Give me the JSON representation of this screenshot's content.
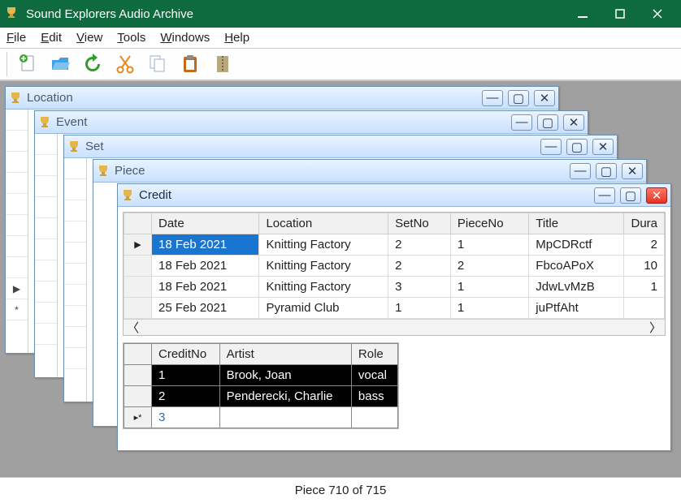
{
  "app": {
    "title": "Sound Explorers Audio Archive"
  },
  "menus": {
    "file": "File",
    "edit": "Edit",
    "view": "View",
    "tools": "Tools",
    "windows": "Windows",
    "help": "Help"
  },
  "windows": {
    "location": "Location",
    "event": "Event",
    "set": "Set",
    "piece": "Piece",
    "credit": "Credit"
  },
  "masterGrid": {
    "headers": {
      "date": "Date",
      "location": "Location",
      "setno": "SetNo",
      "pieceno": "PieceNo",
      "title": "Title",
      "duration": "Dura"
    },
    "rows": [
      {
        "date": "18 Feb 2021",
        "location": "Knitting Factory",
        "setno": "2",
        "pieceno": "1",
        "title": "MpCDRctf",
        "duration": "2"
      },
      {
        "date": "18 Feb 2021",
        "location": "Knitting Factory",
        "setno": "2",
        "pieceno": "2",
        "title": "FbcoAPoX",
        "duration": "10"
      },
      {
        "date": "18 Feb 2021",
        "location": "Knitting Factory",
        "setno": "3",
        "pieceno": "1",
        "title": "JdwLvMzB",
        "duration": "1"
      },
      {
        "date": "25 Feb 2021",
        "location": "Pyramid Club",
        "setno": "1",
        "pieceno": "1",
        "title": "juPtfAht",
        "duration": ""
      }
    ]
  },
  "creditGrid": {
    "headers": {
      "creditno": "CreditNo",
      "artist": "Artist",
      "role": "Role"
    },
    "rows": [
      {
        "creditno": "1",
        "artist": "Brook, Joan",
        "role": "vocal"
      },
      {
        "creditno": "2",
        "artist": "Penderecki, Charlie",
        "role": "bass"
      }
    ],
    "newRowNumber": "3"
  },
  "status": {
    "text": "Piece 710 of 715"
  },
  "stubMarkers": {
    "play": "▶",
    "star": "*",
    "newrow": "▸*"
  }
}
